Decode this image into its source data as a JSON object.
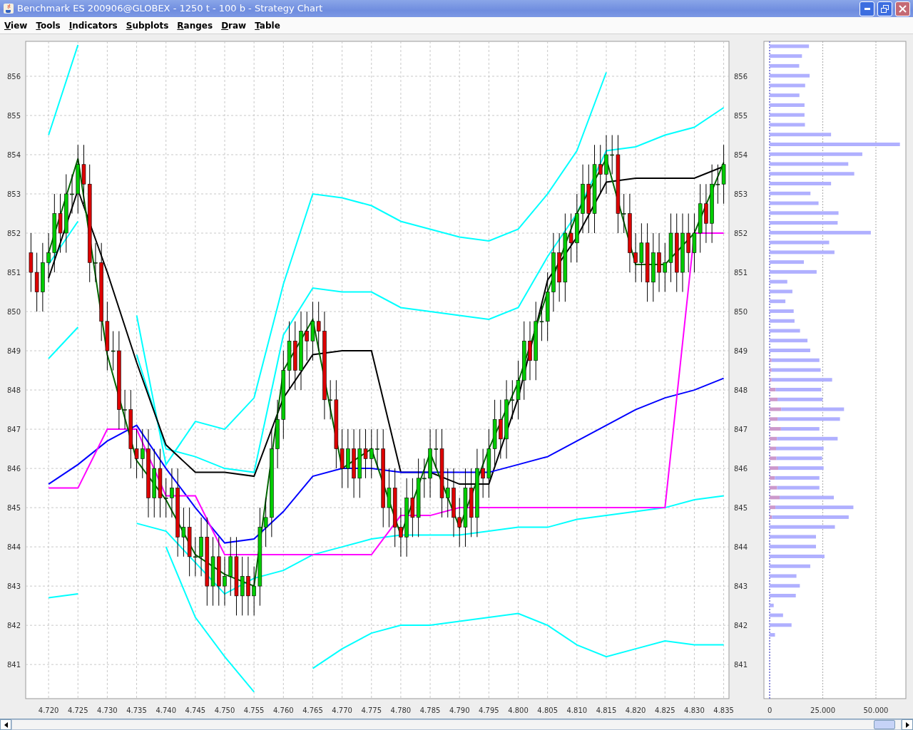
{
  "window": {
    "title": "Benchmark ES 200906@GLOBEX - 1250 t - 100 b - Strategy Chart"
  },
  "menu": [
    "View",
    "Tools",
    "Indicators",
    "Subplots",
    "Ranges",
    "Draw",
    "Table"
  ],
  "price_chart": {
    "chart_data": {
      "type": "candlestick",
      "x": [
        4717,
        4718,
        4719,
        4720,
        4721,
        4722,
        4723,
        4724,
        4725,
        4726,
        4727,
        4728,
        4729,
        4730,
        4731,
        4732,
        4733,
        4734,
        4735,
        4736,
        4737,
        4738,
        4739,
        4740,
        4741,
        4742,
        4743,
        4744,
        4745,
        4746,
        4747,
        4748,
        4749,
        4750,
        4751,
        4752,
        4753,
        4754,
        4755,
        4756,
        4757,
        4758,
        4759,
        4760,
        4761,
        4762,
        4763,
        4764,
        4765,
        4766,
        4767,
        4768,
        4769,
        4770,
        4771,
        4772,
        4773,
        4774,
        4775,
        4776,
        4777,
        4778,
        4779,
        4780,
        4781,
        4782,
        4783,
        4784,
        4785,
        4786,
        4787,
        4788,
        4789,
        4790,
        4791,
        4792,
        4793,
        4794,
        4795,
        4796,
        4797,
        4798,
        4799,
        4800,
        4801,
        4802,
        4803,
        4804,
        4805,
        4806,
        4807,
        4808,
        4809,
        4810,
        4811,
        4812,
        4813,
        4814,
        4815,
        4816,
        4817,
        4818,
        4819,
        4820,
        4821,
        4822,
        4823,
        4824,
        4825,
        4826,
        4827,
        4828,
        4829,
        4830,
        4831,
        4832,
        4833,
        4834,
        4835
      ],
      "ohlc": [
        [
          851.5,
          852,
          850.5,
          851
        ],
        [
          851,
          851.5,
          850,
          850.5
        ],
        [
          850.5,
          851.75,
          850,
          851.25
        ],
        [
          851.25,
          852,
          850.75,
          851.5
        ],
        [
          851.5,
          853,
          851,
          852.5
        ],
        [
          852.5,
          853,
          851.5,
          852
        ],
        [
          852,
          853.5,
          851.5,
          853
        ],
        [
          853,
          853.5,
          852.5,
          853
        ],
        [
          853,
          854.25,
          852.5,
          853.75
        ],
        [
          853.75,
          854.25,
          852.75,
          853.25
        ],
        [
          853.25,
          853.75,
          850.75,
          851.25
        ],
        [
          851.25,
          851.75,
          850.75,
          851.25
        ],
        [
          851.25,
          851.75,
          849.25,
          849.75
        ],
        [
          849.75,
          850.25,
          848.5,
          849
        ],
        [
          849,
          849.5,
          848.5,
          849
        ],
        [
          849,
          849.5,
          847,
          847.5
        ],
        [
          847.5,
          848,
          847,
          847.5
        ],
        [
          847.5,
          848,
          846,
          846.5
        ],
        [
          846.5,
          847,
          845.75,
          846.25
        ],
        [
          846.25,
          847,
          845.75,
          846.5
        ],
        [
          846.5,
          847,
          844.75,
          845.25
        ],
        [
          845.25,
          846.5,
          844.75,
          846
        ],
        [
          846,
          846.5,
          844.75,
          845.25
        ],
        [
          845.25,
          845.75,
          844.75,
          845.25
        ],
        [
          845.25,
          846,
          844.75,
          845.5
        ],
        [
          845.5,
          846,
          843.75,
          844.25
        ],
        [
          844.25,
          845,
          843.75,
          844.5
        ],
        [
          844.5,
          845,
          843.25,
          843.75
        ],
        [
          843.75,
          844.25,
          843.25,
          843.75
        ],
        [
          843.75,
          844.75,
          843.25,
          844.25
        ],
        [
          844.25,
          844.75,
          842.5,
          843
        ],
        [
          843,
          844.25,
          842.5,
          843.75
        ],
        [
          843.75,
          844.25,
          842.5,
          843
        ],
        [
          843,
          843.75,
          842.5,
          843.25
        ],
        [
          843.25,
          844.25,
          842.75,
          843.75
        ],
        [
          843.75,
          844.25,
          842.25,
          842.75
        ],
        [
          842.75,
          843.75,
          842.25,
          843.25
        ],
        [
          843.25,
          843.75,
          842.25,
          842.75
        ],
        [
          842.75,
          843.5,
          842.25,
          843
        ],
        [
          843,
          845,
          842.5,
          844.5
        ],
        [
          844.5,
          845.25,
          844,
          844.75
        ],
        [
          844.75,
          847,
          844.25,
          846.5
        ],
        [
          846.5,
          847.75,
          846,
          847.25
        ],
        [
          847.25,
          849,
          846.75,
          848.5
        ],
        [
          848.5,
          849.75,
          848,
          849.25
        ],
        [
          849.25,
          849.75,
          848,
          848.5
        ],
        [
          848.5,
          850,
          848,
          849.5
        ],
        [
          849.5,
          850,
          848.75,
          849.25
        ],
        [
          849.25,
          850.25,
          848.75,
          849.75
        ],
        [
          849.75,
          850.25,
          849,
          849.5
        ],
        [
          849.5,
          850,
          847.25,
          847.75
        ],
        [
          847.75,
          848.25,
          847.25,
          847.75
        ],
        [
          847.75,
          848.25,
          846,
          846.5
        ],
        [
          846.5,
          847,
          845.5,
          846
        ],
        [
          846,
          847,
          845.5,
          846.5
        ],
        [
          846.5,
          847,
          845.25,
          845.75
        ],
        [
          845.75,
          847,
          845.25,
          846.5
        ],
        [
          846.5,
          847,
          845.75,
          846.25
        ],
        [
          846.25,
          847,
          845.75,
          846.5
        ],
        [
          846.5,
          847,
          846,
          846.5
        ],
        [
          846.5,
          847,
          844.5,
          845
        ],
        [
          845,
          846,
          844.5,
          845.5
        ],
        [
          845.5,
          846,
          844,
          844.5
        ],
        [
          844.5,
          845,
          843.75,
          844.25
        ],
        [
          844.25,
          845.75,
          843.75,
          845.25
        ],
        [
          845.25,
          845.75,
          844.25,
          844.75
        ],
        [
          844.75,
          846.25,
          844.25,
          845.75
        ],
        [
          845.75,
          846.25,
          845.25,
          845.75
        ],
        [
          845.75,
          847,
          845.25,
          846.5
        ],
        [
          846.5,
          847,
          846,
          846.5
        ],
        [
          846.5,
          847,
          844.75,
          845.25
        ],
        [
          845.25,
          846,
          844.75,
          845.5
        ],
        [
          845.5,
          846,
          844.25,
          844.75
        ],
        [
          844.75,
          845.25,
          844,
          844.5
        ],
        [
          844.5,
          846,
          844,
          845.5
        ],
        [
          845.5,
          846,
          844.25,
          844.75
        ],
        [
          844.75,
          846.5,
          844.25,
          846
        ],
        [
          846,
          846.5,
          845.25,
          845.75
        ],
        [
          845.75,
          847,
          845.25,
          846.5
        ],
        [
          846.5,
          847.75,
          846,
          847.25
        ],
        [
          847.25,
          847.75,
          846.25,
          846.75
        ],
        [
          846.75,
          848.25,
          846.25,
          847.75
        ],
        [
          847.75,
          848.25,
          847.25,
          847.75
        ],
        [
          847.75,
          848.75,
          847.25,
          848.25
        ],
        [
          848.25,
          849.75,
          847.75,
          849.25
        ],
        [
          849.25,
          849.75,
          848.25,
          848.75
        ],
        [
          848.75,
          850.25,
          848.25,
          849.75
        ],
        [
          849.75,
          850.25,
          849.25,
          849.75
        ],
        [
          849.75,
          851,
          849.25,
          850.5
        ],
        [
          850.5,
          852,
          850,
          851.5
        ],
        [
          851.5,
          852,
          850.25,
          850.75
        ],
        [
          850.75,
          852.5,
          850.25,
          852
        ],
        [
          852,
          852.5,
          851.25,
          851.75
        ],
        [
          851.75,
          853,
          851.25,
          852.5
        ],
        [
          852.5,
          853.75,
          852,
          853.25
        ],
        [
          853.25,
          853.75,
          852,
          852.5
        ],
        [
          852.5,
          854.25,
          852,
          853.75
        ],
        [
          853.75,
          854.25,
          853,
          853.5
        ],
        [
          853.5,
          854.5,
          853,
          854
        ],
        [
          854,
          854.5,
          853.5,
          854
        ],
        [
          854,
          854.5,
          852,
          852.5
        ],
        [
          852.5,
          853,
          852,
          852.5
        ],
        [
          852.5,
          853,
          851,
          851.5
        ],
        [
          851.5,
          852,
          850.75,
          851.25
        ],
        [
          851.25,
          852.25,
          850.75,
          851.75
        ],
        [
          851.75,
          852.25,
          850.25,
          850.75
        ],
        [
          850.75,
          852,
          850.25,
          851.5
        ],
        [
          851.5,
          852,
          850.5,
          851
        ],
        [
          851,
          851.75,
          850.5,
          851.25
        ],
        [
          851.25,
          852.5,
          850.75,
          852
        ],
        [
          852,
          852.5,
          850.5,
          851
        ],
        [
          851,
          852.5,
          850.5,
          852
        ],
        [
          852,
          852.5,
          851,
          851.5
        ],
        [
          851.5,
          852.5,
          851,
          852
        ],
        [
          852,
          853.25,
          851.5,
          852.75
        ],
        [
          852.75,
          853.25,
          851.75,
          852.25
        ],
        [
          852.25,
          853.75,
          851.75,
          853.25
        ],
        [
          853.25,
          853.75,
          852.75,
          853.25
        ],
        [
          853.25,
          854.25,
          852.75,
          853.75
        ]
      ],
      "xlim": [
        4716.1,
        4835.9
      ],
      "ylim": [
        840.13,
        856.89
      ],
      "xticks": [
        {
          "value": 4720,
          "label": "4.720"
        },
        {
          "value": 4725,
          "label": "4.725"
        },
        {
          "value": 4730,
          "label": "4.730"
        },
        {
          "value": 4735,
          "label": "4.735"
        },
        {
          "value": 4740,
          "label": "4.740"
        },
        {
          "value": 4745,
          "label": "4.745"
        },
        {
          "value": 4750,
          "label": "4.750"
        },
        {
          "value": 4755,
          "label": "4.755"
        },
        {
          "value": 4760,
          "label": "4.760"
        },
        {
          "value": 4765,
          "label": "4.765"
        },
        {
          "value": 4770,
          "label": "4.770"
        },
        {
          "value": 4775,
          "label": "4.775"
        },
        {
          "value": 4780,
          "label": "4.780"
        },
        {
          "value": 4785,
          "label": "4.785"
        },
        {
          "value": 4790,
          "label": "4.790"
        },
        {
          "value": 4795,
          "label": "4.795"
        },
        {
          "value": 4800,
          "label": "4.800"
        },
        {
          "value": 4805,
          "label": "4.805"
        },
        {
          "value": 4810,
          "label": "4.810"
        },
        {
          "value": 4815,
          "label": "4.815"
        },
        {
          "value": 4820,
          "label": "4.820"
        },
        {
          "value": 4825,
          "label": "4.825"
        },
        {
          "value": 4830,
          "label": "4.830"
        },
        {
          "value": 4835,
          "label": "4.835"
        }
      ],
      "yticks": [
        841,
        842,
        843,
        844,
        845,
        846,
        847,
        848,
        849,
        850,
        851,
        852,
        853,
        854,
        855,
        856
      ],
      "grid": true
    }
  },
  "indicators": {
    "chart_data": {
      "type": "line",
      "x": [
        4720,
        4725,
        4730,
        4735,
        4740,
        4745,
        4750,
        4755,
        4760,
        4765,
        4770,
        4775,
        4780,
        4785,
        4790,
        4795,
        4800,
        4805,
        4810,
        4815,
        4820,
        4825,
        4830,
        4835
      ],
      "series": [
        {
          "color": "#00ffff",
          "values": [
            854.5,
            856.8,
            null,
            849.9,
            846.1,
            847.2,
            847.0,
            847.8,
            850.7,
            853.0,
            852.9,
            852.7,
            852.3,
            852.1,
            851.9,
            851.8,
            852.1,
            853.0,
            854.1,
            856.1,
            null,
            null,
            null,
            null
          ]
        },
        {
          "color": "#00ffff",
          "values": [
            848.8,
            849.6,
            null,
            848.9,
            846.5,
            846.3,
            846.0,
            845.9,
            849.4,
            850.6,
            850.5,
            850.5,
            850.1,
            850.0,
            849.9,
            849.8,
            850.1,
            851.4,
            852.5,
            854.1,
            854.2,
            854.5,
            854.7,
            855.2
          ]
        },
        {
          "color": "#00ffff",
          "values": [
            851.2,
            852.3,
            null,
            844.6,
            844.4,
            843.6,
            842.8,
            843.2,
            843.4,
            843.8,
            844.0,
            844.2,
            844.3,
            844.3,
            844.3,
            844.4,
            844.5,
            844.5,
            844.7,
            844.8,
            844.9,
            845.0,
            845.2,
            845.3
          ]
        },
        {
          "color": "#00ffff",
          "values": [
            842.7,
            842.8,
            null,
            null,
            844.0,
            842.2,
            841.2,
            840.3,
            null,
            840.9,
            841.4,
            841.8,
            842.0,
            842.0,
            842.1,
            842.2,
            842.3,
            842.0,
            841.5,
            841.2,
            841.4,
            841.6,
            841.5,
            841.5
          ]
        },
        {
          "color": "#000000",
          "values": [
            850.85,
            853.1,
            851.0,
            848.7,
            846.6,
            845.9,
            845.9,
            845.8,
            847.8,
            848.9,
            849.0,
            849.0,
            845.9,
            845.9,
            845.6,
            845.6,
            847.8,
            850.8,
            851.9,
            853.3,
            853.4,
            853.4,
            853.4,
            853.7
          ]
        },
        {
          "color": "#0000ff",
          "values": [
            845.6,
            846.1,
            846.7,
            847.1,
            846.0,
            845.0,
            844.1,
            844.2,
            844.9,
            845.8,
            846.0,
            846.0,
            845.9,
            845.9,
            845.9,
            845.9,
            846.1,
            846.3,
            846.7,
            847.1,
            847.5,
            847.8,
            848.0,
            848.3
          ]
        },
        {
          "color": "#ff00ff",
          "values": [
            845.5,
            845.5,
            847.0,
            847.0,
            845.3,
            845.3,
            843.8,
            843.8,
            843.8,
            843.8,
            843.8,
            843.8,
            844.8,
            844.8,
            845.0,
            845.0,
            845.0,
            845.0,
            845.0,
            845.0,
            845.0,
            845.0,
            852.0,
            852.0
          ]
        },
        {
          "color": "#006600",
          "values": [
            851.5,
            853.9,
            848.9,
            846.2,
            845.2,
            843.8,
            843.3,
            843.0,
            848.5,
            849.8,
            846.0,
            846.5,
            844.3,
            846.4,
            844.5,
            846.5,
            848.2,
            850.5,
            852.5,
            853.9,
            851.2,
            851.2,
            852.0,
            853.8
          ]
        }
      ],
      "xlim": [
        4716.1,
        4835.9
      ],
      "ylim": [
        840.13,
        856.89
      ],
      "yticks": [
        841,
        842,
        843,
        844,
        845,
        846,
        847,
        848,
        849,
        850,
        851,
        852,
        853,
        854,
        855,
        856
      ]
    }
  },
  "volume_profile": {
    "chart_data": {
      "type": "bar",
      "orientation": "horizontal",
      "stacked": true,
      "categories": [
        null,
        null,
        null,
        null,
        null,
        null,
        null,
        null,
        null,
        null,
        null,
        null,
        null,
        null,
        null,
        null,
        null,
        null,
        null,
        null,
        null,
        null,
        null,
        null,
        null,
        null,
        null,
        null,
        null,
        null,
        null,
        null,
        null,
        null,
        null,
        null,
        null,
        null,
        null,
        null,
        null,
        null,
        null,
        null,
        null,
        null,
        null,
        null,
        null,
        null,
        null,
        null,
        null,
        null,
        null,
        null,
        null,
        null,
        null,
        null,
        null,
        null,
        null,
        null,
        null,
        null,
        null
      ],
      "series": [
        {
          "color": "#cc99cc",
          "values": [
            null,
            null,
            null,
            null,
            null,
            null,
            null,
            null,
            null,
            null,
            null,
            null,
            null,
            null,
            null,
            null,
            null,
            null,
            null,
            null,
            null,
            null,
            null,
            null,
            null,
            null,
            null,
            null,
            null,
            null,
            null,
            null,
            900,
            900,
            900,
            2800,
            3700,
            5400,
            3700,
            5300,
            3400,
            3000,
            3200,
            4000,
            2500,
            3500,
            4700,
            2700,
            1100,
            null,
            null,
            null,
            null,
            null,
            null,
            null,
            null,
            null,
            null,
            null,
            null,
            null,
            null,
            null,
            null,
            null,
            null
          ]
        },
        {
          "color": "#b0b0ff",
          "values": [
            18500,
            15200,
            13900,
            18800,
            16700,
            14000,
            16400,
            16400,
            16600,
            28900,
            61300,
            43600,
            37000,
            39800,
            28900,
            19200,
            23000,
            32400,
            32000,
            47600,
            28000,
            30500,
            16100,
            22100,
            8300,
            10700,
            7400,
            11300,
            11700,
            14300,
            17800,
            19100,
            22500,
            23100,
            28500,
            21500,
            21200,
            29600,
            29400,
            18100,
            28600,
            22400,
            21500,
            21400,
            20900,
            19900,
            25500,
            36700,
            36100,
            30700,
            21800,
            21800,
            25800,
            19100,
            12600,
            14200,
            12300,
            1900,
            6300,
            10300,
            2500,
            null,
            null,
            null,
            null,
            null,
            null
          ]
        }
      ],
      "xlim": [
        -2700,
        64100
      ],
      "grid": true,
      "ref_lines": [
        {
          "axis": "x",
          "value": 0,
          "color": "#4040e0"
        }
      ],
      "xticks": [
        0,
        {
          "value": 25000,
          "label": "25.000"
        },
        {
          "value": 50000,
          "label": "50.000"
        }
      ]
    }
  }
}
